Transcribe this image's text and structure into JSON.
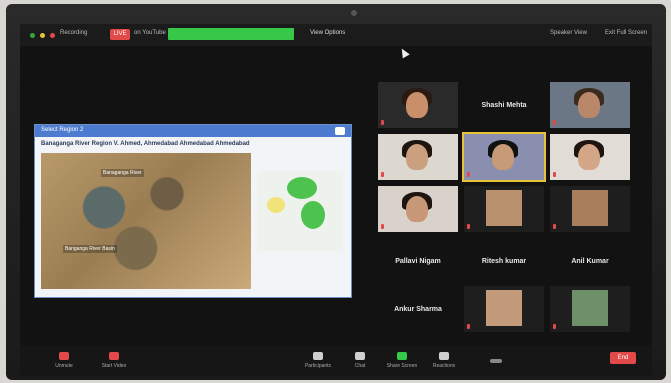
{
  "topbar": {
    "recording_label": "Recording",
    "live_label": "LIVE",
    "live_sub": "on YouTube",
    "view_options": "View Options",
    "speaker_view": "Speaker View",
    "fullscreen": "Exit Full Screen"
  },
  "slide": {
    "header": "Select Region 2",
    "title": "Banaganga River Region  V. Ahmed, Ahmedabad Ahmedabad Ahmedabad",
    "map_label": "Banaganga River",
    "map_label2": "Banganga River Basin"
  },
  "participants": [
    {
      "name": "",
      "type": "video"
    },
    {
      "name": "Shashi Mehta",
      "type": "name"
    },
    {
      "name": "",
      "type": "video"
    },
    {
      "name": "",
      "type": "video"
    },
    {
      "name": "",
      "type": "video"
    },
    {
      "name": "",
      "type": "video"
    },
    {
      "name": "",
      "type": "video"
    },
    {
      "name": "",
      "type": "video"
    },
    {
      "name": "",
      "type": "video"
    },
    {
      "name": "Pallavi Nigam",
      "type": "name"
    },
    {
      "name": "Ritesh kumar",
      "type": "name"
    },
    {
      "name": "Anil Kumar",
      "type": "name"
    },
    {
      "name": "Ankur Sharma",
      "type": "name"
    },
    {
      "name": "",
      "type": "video"
    },
    {
      "name": "",
      "type": "video"
    }
  ],
  "toolbar": {
    "unmute": "Unmute",
    "start_video": "Start Video",
    "participants": "Participants",
    "chat": "Chat",
    "share_screen": "Share Screen",
    "reactions": "Reactions",
    "end": "End"
  }
}
